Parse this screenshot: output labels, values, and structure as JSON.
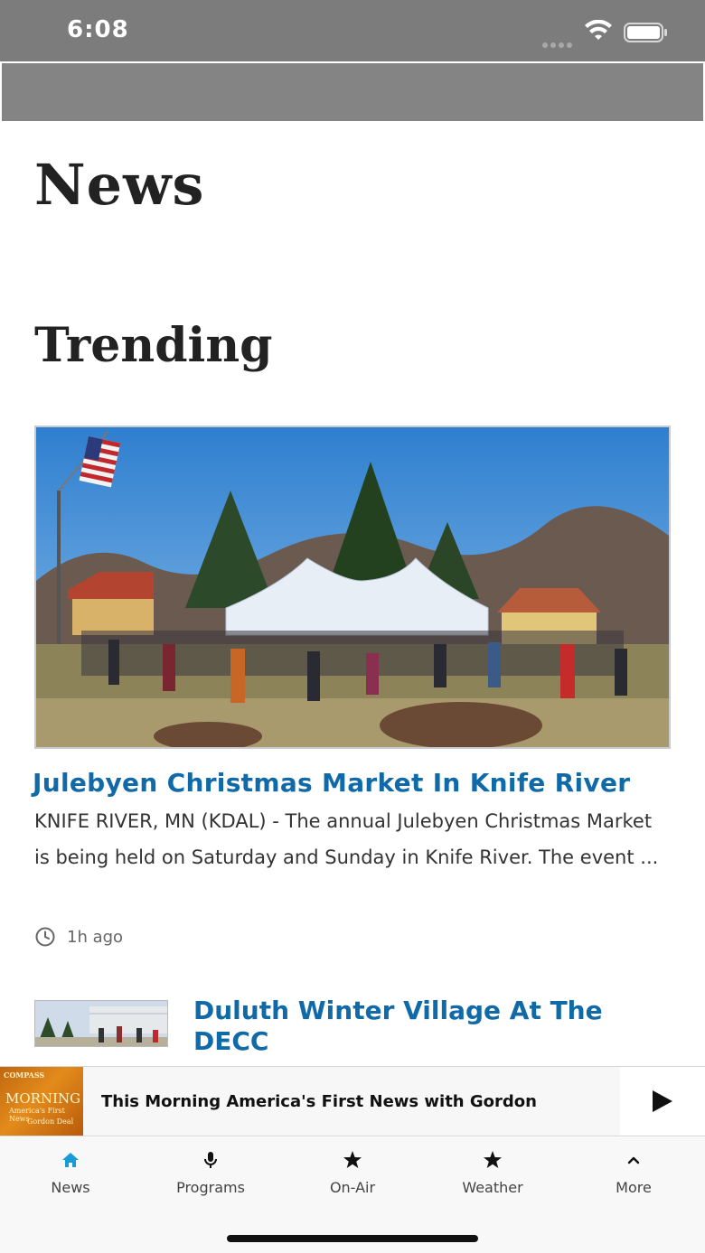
{
  "status_bar": {
    "time": "6:08"
  },
  "page": {
    "title": "News",
    "section_title": "Trending"
  },
  "articles": [
    {
      "title": "Julebyen Christmas Market In Knife River",
      "excerpt": "KNIFE RIVER, MN (KDAL) - The annual Julebyen Christmas Market is being held on Saturday and Sunday in Knife River. The event ...",
      "time": "1h ago"
    },
    {
      "title": "Duluth Winter Village At The DECC"
    }
  ],
  "player": {
    "title": "This Morning America's First News with Gordon",
    "art_text": {
      "brand": "COMPASS",
      "show": "MORNING",
      "subtitle": "America's First News",
      "host": "Gordon Deal"
    }
  },
  "tabs": [
    {
      "label": "News",
      "icon": "home-icon"
    },
    {
      "label": "Programs",
      "icon": "microphone-icon"
    },
    {
      "label": "On-Air",
      "icon": "star-icon"
    },
    {
      "label": "Weather",
      "icon": "star-icon"
    },
    {
      "label": "More",
      "icon": "chevron-up-icon"
    }
  ],
  "colors": {
    "accent": "#116aa8",
    "active_tab": "#1a9bd7",
    "status_bar": "#7c7c7c",
    "header": "#848484"
  }
}
